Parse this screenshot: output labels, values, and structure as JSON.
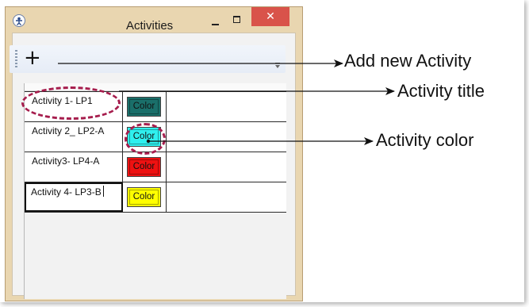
{
  "window": {
    "title": "Activities",
    "close_glyph": "✕",
    "frame_color": "#e9d6b0"
  },
  "toolbar": {
    "add_glyph": "+",
    "add_icon": "plus-icon",
    "overflow_icon": "chevron-down-icon"
  },
  "activities": [
    {
      "title": "Activity 1- LP1",
      "color_label": "Color",
      "color": "#1a6f6a"
    },
    {
      "title": "Activity 2_ LP2-A",
      "color_label": "Color",
      "color": "#2ff0ef"
    },
    {
      "title": "Activity3- LP4-A",
      "color_label": "Color",
      "color": "#ee1111"
    },
    {
      "title": "Activity 4- LP3-B",
      "color_label": "Color",
      "color": "#ffff00"
    }
  ],
  "annotations": {
    "add_new": "Add new Activity",
    "activity_title": "Activity title",
    "activity_color": "Activity color",
    "highlight_color": "#a61d4d"
  }
}
